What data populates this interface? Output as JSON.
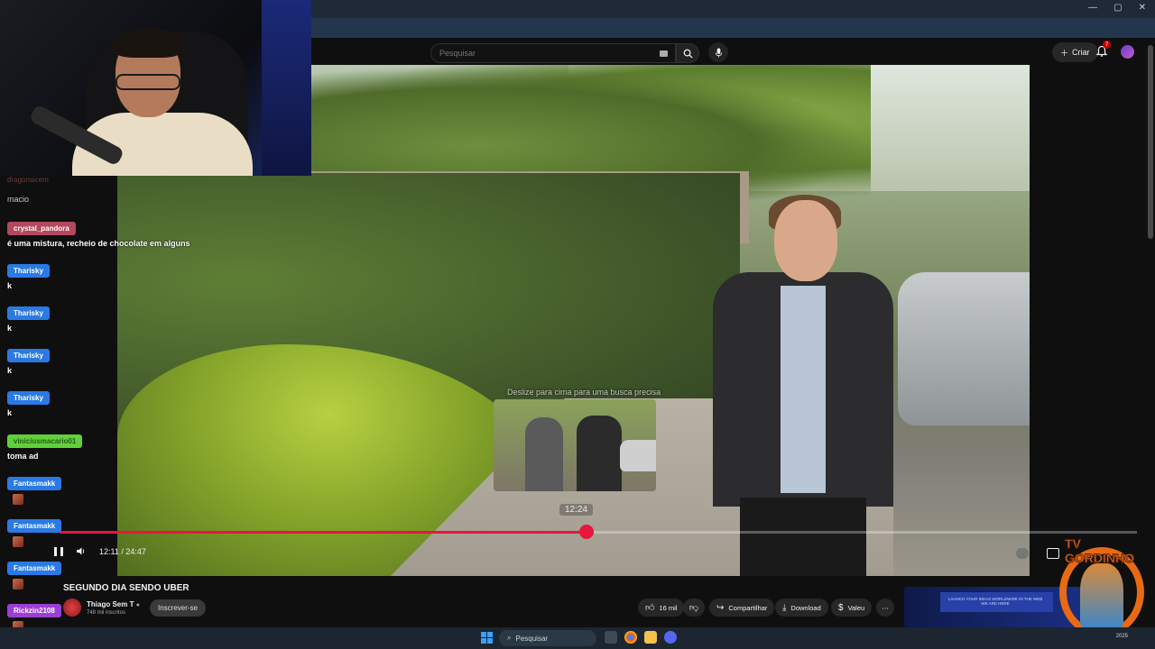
{
  "header": {
    "search_placeholder": "Pesquisar",
    "create_label": "Criar",
    "notification_count": "7"
  },
  "video": {
    "hover_hint": "Deslize para cima para uma busca precisa",
    "hover_time": "12:24",
    "current_time": "12:11",
    "separator": "/",
    "duration": "24:47",
    "played_fraction": 0.4889,
    "buffered_fraction": 0.4889
  },
  "chat": {
    "truncated_user": "dragonsicem",
    "messages": [
      {
        "user": "",
        "text": "macio",
        "color": "#6b2a2a"
      },
      {
        "user": "crystal_pandora",
        "text": "é uma mistura, recheio de chocolate em alguns",
        "color": "#b4485f"
      },
      {
        "user": "Tharisky",
        "text": "k",
        "color": "#2a7ae6"
      },
      {
        "user": "Tharisky",
        "text": "k",
        "color": "#2a7ae6"
      },
      {
        "user": "Tharisky",
        "text": "k",
        "color": "#2a7ae6"
      },
      {
        "user": "Tharisky",
        "text": "k",
        "color": "#2a7ae6"
      },
      {
        "user": "viniciusmacario01",
        "text": "toma ad",
        "color": "#5fd13a"
      },
      {
        "user": "Fantasmakk",
        "text": "",
        "color": "#2a7ae6"
      },
      {
        "user": "Fantasmakk",
        "text": "",
        "color": "#2a7ae6"
      },
      {
        "user": "Fantasmakk",
        "text": "",
        "color": "#2a7ae6"
      },
      {
        "user": "Rickzin2108",
        "text": "",
        "color": "#9b3fd6"
      }
    ]
  },
  "info": {
    "title": "SEGUNDO DIA SENDO UBER",
    "channel": "Thiago Sem T",
    "subscribers": "748 mil inscritos",
    "subscribe_label": "Inscrever-se",
    "likes": "16 mil",
    "share_label": "Compartilhar",
    "download_label": "Download",
    "thanks_label": "Valeu",
    "ad_caption": "LAUNCH YOUR IDEAS WORLDWIDE IN THE WEB WE ARE HERE"
  },
  "logo": {
    "text": "TV GORDINHO"
  },
  "taskbar": {
    "search_placeholder": "Pesquisar",
    "tray_date": "2025"
  },
  "colors": {
    "accent": "#e5173d",
    "background": "#0f0f0f"
  }
}
